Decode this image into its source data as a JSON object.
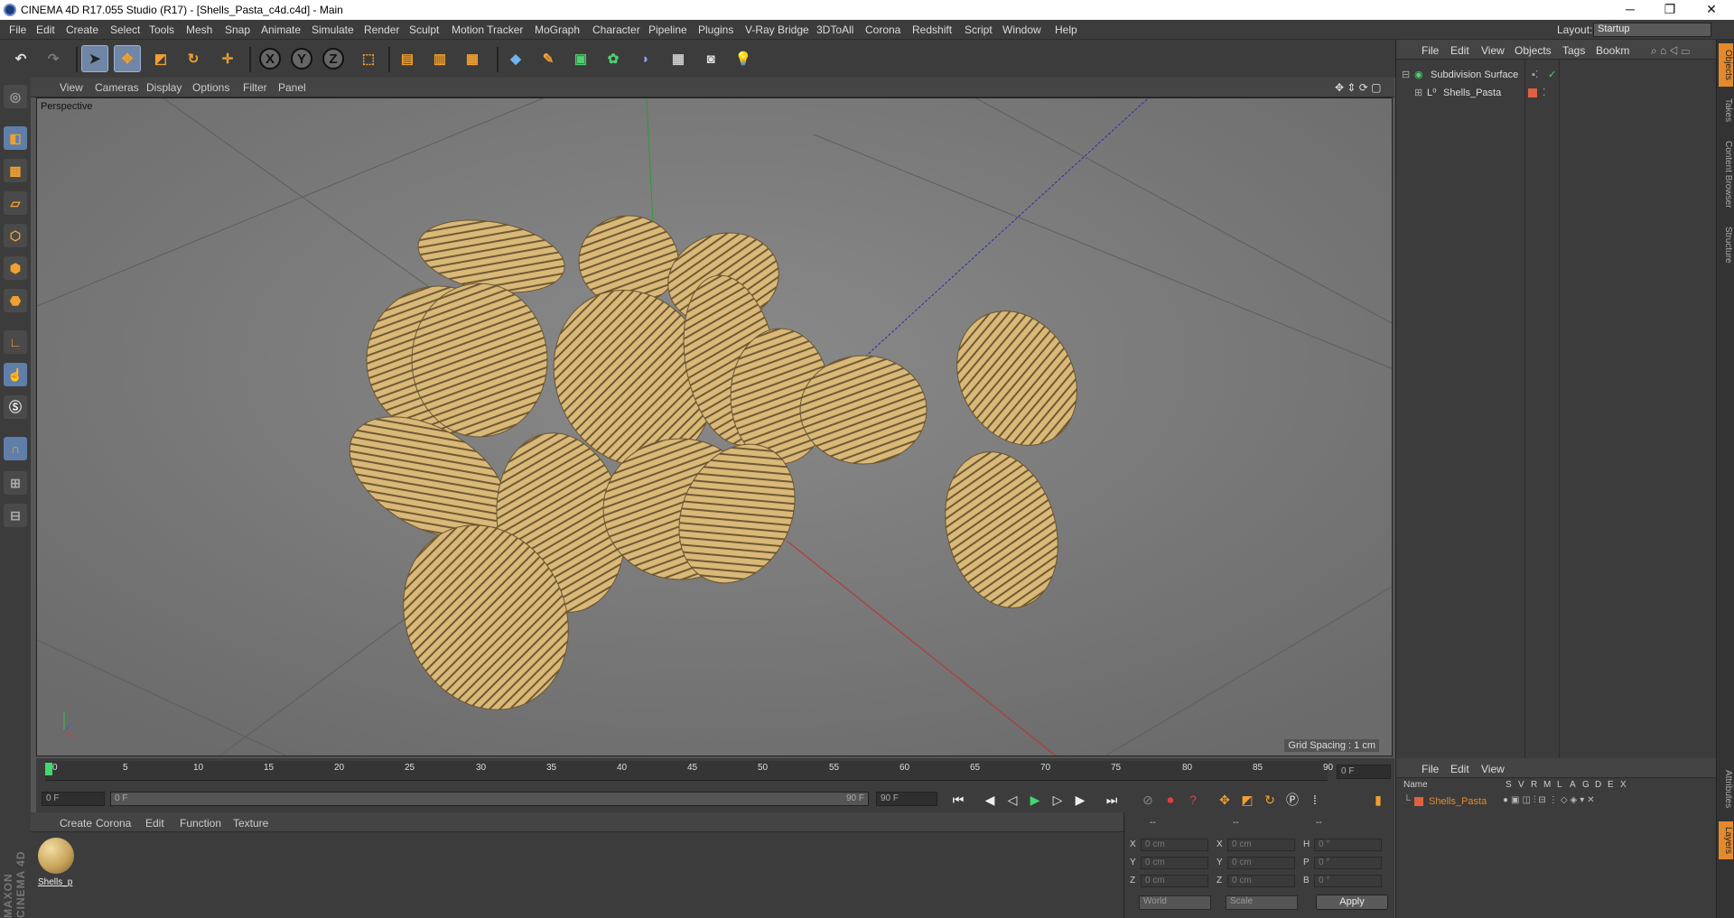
{
  "window": {
    "title": "CINEMA 4D R17.055 Studio (R17) - [Shells_Pasta_c4d.c4d] - Main",
    "minimize": "─",
    "restore": "❐",
    "close": "✕"
  },
  "menu": [
    "File",
    "Edit",
    "Create",
    "Select",
    "Tools",
    "Mesh",
    "Snap",
    "Animate",
    "Simulate",
    "Render",
    "Sculpt",
    "Motion Tracker",
    "MoGraph",
    "Character",
    "Pipeline",
    "Plugins",
    "V-Ray Bridge",
    "3DToAll",
    "Corona",
    "Redshift",
    "Script",
    "Window",
    "Help"
  ],
  "layout": {
    "label": "Layout:",
    "value": "Startup"
  },
  "toolbar": {
    "x": "X",
    "y": "Y",
    "z": "Z"
  },
  "viewport": {
    "menu": [
      "View",
      "Cameras",
      "Display",
      "Options",
      "Filter",
      "Panel"
    ],
    "camera_label": "Perspective",
    "grid_spacing": "Grid Spacing : 1 cm"
  },
  "timeline": {
    "ticks": [
      "0",
      "5",
      "10",
      "15",
      "20",
      "25",
      "30",
      "35",
      "40",
      "45",
      "50",
      "55",
      "60",
      "65",
      "70",
      "75",
      "80",
      "85",
      "90"
    ],
    "current_frame": "0 F",
    "start_field": "0 F",
    "range_start": "0 F",
    "range_end": "90 F",
    "end_field": "90 F"
  },
  "material_manager": {
    "menu": [
      "Create",
      "Corona",
      "Edit",
      "Function",
      "Texture"
    ],
    "material_name": "Shells_p"
  },
  "coordinates": {
    "header": [
      "--",
      "--",
      "--"
    ],
    "rows": [
      {
        "a": "X",
        "av": "0 cm",
        "b": "X",
        "bv": "0 cm",
        "c": "H",
        "cv": "0 °"
      },
      {
        "a": "Y",
        "av": "0 cm",
        "b": "Y",
        "bv": "0 cm",
        "c": "P",
        "cv": "0 °"
      },
      {
        "a": "Z",
        "av": "0 cm",
        "b": "Z",
        "bv": "0 cm",
        "c": "B",
        "cv": "0 °"
      }
    ],
    "mode": "World",
    "size_mode": "Scale",
    "apply": "Apply"
  },
  "objects_panel": {
    "menu": [
      "File",
      "Edit",
      "View",
      "Objects",
      "Tags",
      "Bookm"
    ],
    "items": [
      "Subdivision Surface",
      "Shells_Pasta"
    ]
  },
  "layers_panel": {
    "menu": [
      "File",
      "Edit",
      "View"
    ],
    "columns": [
      "Name",
      "S",
      "V",
      "R",
      "M",
      "L",
      "A",
      "G",
      "D",
      "E",
      "X"
    ],
    "items": [
      "Shells_Pasta"
    ]
  },
  "right_tabs": [
    "Objects",
    "Takes",
    "Content Browser",
    "Structure",
    "Attributes",
    "Layers"
  ],
  "branding": "MAXON CINEMA 4D",
  "colors": {
    "accent": "#e38a2c",
    "pasta": "#d8b677",
    "selected_tool": "#6f86a6"
  }
}
